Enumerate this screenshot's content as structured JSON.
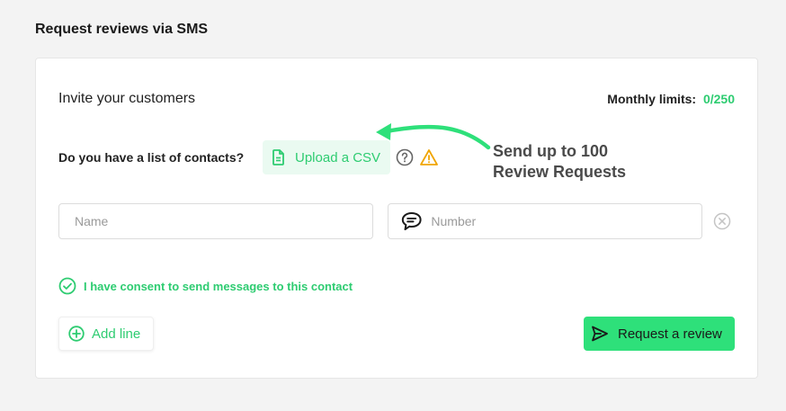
{
  "page": {
    "title": "Request reviews via SMS"
  },
  "card": {
    "title": "Invite your customers",
    "limits_label": "Monthly limits:",
    "limits_value": "0/250",
    "contacts_question": "Do you have a list of contacts?",
    "upload_label": "Upload a CSV",
    "annotation_line1": "Send up to 100",
    "annotation_line2": "Review Requests",
    "name_placeholder": "Name",
    "number_placeholder": "Number",
    "consent_label": "I have consent to send messages to this contact",
    "add_line_label": "Add line",
    "request_label": "Request a review"
  },
  "colors": {
    "accent": "#2ecc71",
    "button_green": "#2ee07a",
    "warning": "#f0a500",
    "background": "#f3f3f3"
  },
  "icons": [
    "file-icon",
    "help-icon",
    "warning-icon",
    "chat-icon",
    "clear-icon",
    "check-circle-icon",
    "plus-circle-icon",
    "send-icon",
    "arrow-icon"
  ]
}
